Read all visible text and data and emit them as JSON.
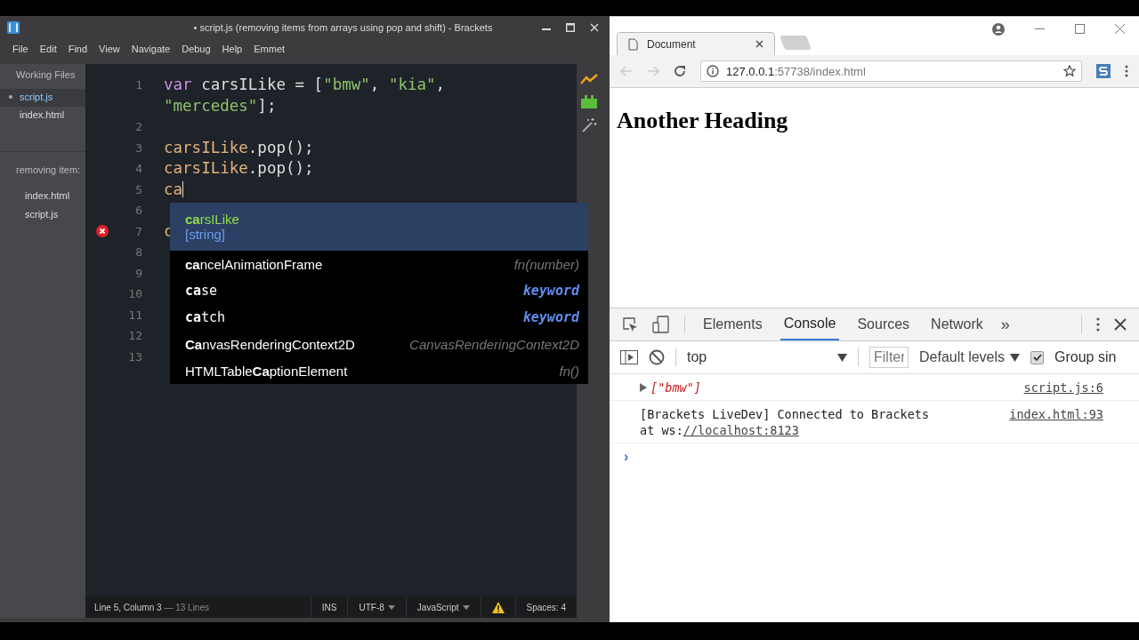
{
  "editor_window": {
    "title": "• script.js (removing items from arrays using pop and shift) - Brackets",
    "menu": [
      "File",
      "Edit",
      "Find",
      "View",
      "Navigate",
      "Debug",
      "Help",
      "Emmet"
    ],
    "sidebar": {
      "working_files_title": "Working Files",
      "working_files": [
        {
          "name": "script.js",
          "selected": true,
          "modified": true
        },
        {
          "name": "index.html",
          "selected": false,
          "modified": false
        }
      ],
      "project_title": "removing item:",
      "project_files": [
        {
          "name": "index.html",
          "selected": false
        },
        {
          "name": "script.js",
          "selected": false
        }
      ]
    },
    "code_lines": [
      {
        "number": "1",
        "error": false,
        "rows": [
          [
            {
              "text": "var",
              "kind": "keyword"
            },
            {
              "text": " carsILike = [",
              "kind": "plain"
            },
            {
              "text": "\"bmw\"",
              "kind": "string"
            },
            {
              "text": ", ",
              "kind": "plain"
            },
            {
              "text": "\"kia\"",
              "kind": "string"
            },
            {
              "text": ",",
              "kind": "plain"
            }
          ],
          [
            {
              "text": "\"mercedes\"",
              "kind": "string"
            },
            {
              "text": "];",
              "kind": "plain"
            }
          ]
        ]
      },
      {
        "number": "2",
        "error": false,
        "rows": [
          []
        ]
      },
      {
        "number": "3",
        "error": false,
        "rows": [
          [
            {
              "text": "carsILike",
              "kind": "variable"
            },
            {
              "text": ".pop();",
              "kind": "plain"
            }
          ]
        ]
      },
      {
        "number": "4",
        "error": false,
        "rows": [
          [
            {
              "text": "carsILike",
              "kind": "variable"
            },
            {
              "text": ".pop();",
              "kind": "plain"
            }
          ]
        ]
      },
      {
        "number": "5",
        "error": false,
        "rows": [
          [
            {
              "text": "ca",
              "kind": "variable"
            }
          ]
        ]
      },
      {
        "number": "6",
        "error": false,
        "rows": [
          []
        ]
      },
      {
        "number": "7",
        "error": true,
        "rows": [
          [
            {
              "text": "c",
              "kind": "variable"
            }
          ]
        ]
      },
      {
        "number": "8",
        "error": false,
        "rows": [
          []
        ]
      },
      {
        "number": "9",
        "error": false,
        "rows": [
          []
        ]
      },
      {
        "number": "10",
        "error": false,
        "rows": [
          []
        ]
      },
      {
        "number": "11",
        "error": false,
        "rows": [
          []
        ]
      },
      {
        "number": "12",
        "error": false,
        "rows": [
          []
        ]
      },
      {
        "number": "13",
        "error": false,
        "rows": [
          []
        ]
      }
    ],
    "hints": [
      {
        "label": "**ca**rsILike",
        "type": "[string]",
        "kind": "variable",
        "selected": true
      },
      {
        "label": "**ca**ncelAnimationFrame",
        "type": "fn(number)",
        "kind": "function",
        "selected": false
      },
      {
        "label": "**ca**se",
        "type": "keyword",
        "kind": "keyword",
        "selected": false
      },
      {
        "label": "**ca**tch",
        "type": "keyword",
        "kind": "keyword",
        "selected": false
      },
      {
        "label": "**Ca**nvasRenderingContext2D",
        "type": "CanvasRenderingContext2D",
        "kind": "function",
        "selected": false
      },
      {
        "label": "HTMLTable**Ca**ptionElement",
        "type": "fn()",
        "kind": "function",
        "selected": false
      }
    ],
    "status_bar": {
      "position": "Line 5, Column 3",
      "line_count": "— 13 Lines",
      "mode": "INS",
      "encoding": "UTF-8",
      "language": "JavaScript",
      "indent": "Spaces: 4"
    }
  },
  "browser_window": {
    "tab": {
      "title": "Document",
      "selected": true
    },
    "url_host": "127.0.0.1",
    "url_rest": ":57738/index.html",
    "page_heading": "Another Heading",
    "devtools": {
      "tabs": [
        {
          "label": "Elements",
          "selected": false
        },
        {
          "label": "Console",
          "selected": true
        },
        {
          "label": "Sources",
          "selected": false
        },
        {
          "label": "Network",
          "selected": false
        }
      ],
      "more": "»",
      "context": "top",
      "filter_placeholder": "Filter",
      "levels": "Default levels",
      "group_similar": {
        "label": "Group sin",
        "checked": true
      },
      "messages": [
        {
          "kind": "array",
          "text": "[\"bmw\"]",
          "source": "script.js:6"
        },
        {
          "kind": "log",
          "text": "[Brackets LiveDev] Connected to Brackets",
          "text2": "at ws:",
          "link": "//localhost:8123",
          "source": "index.html:93"
        }
      ],
      "prompt": "›"
    }
  }
}
